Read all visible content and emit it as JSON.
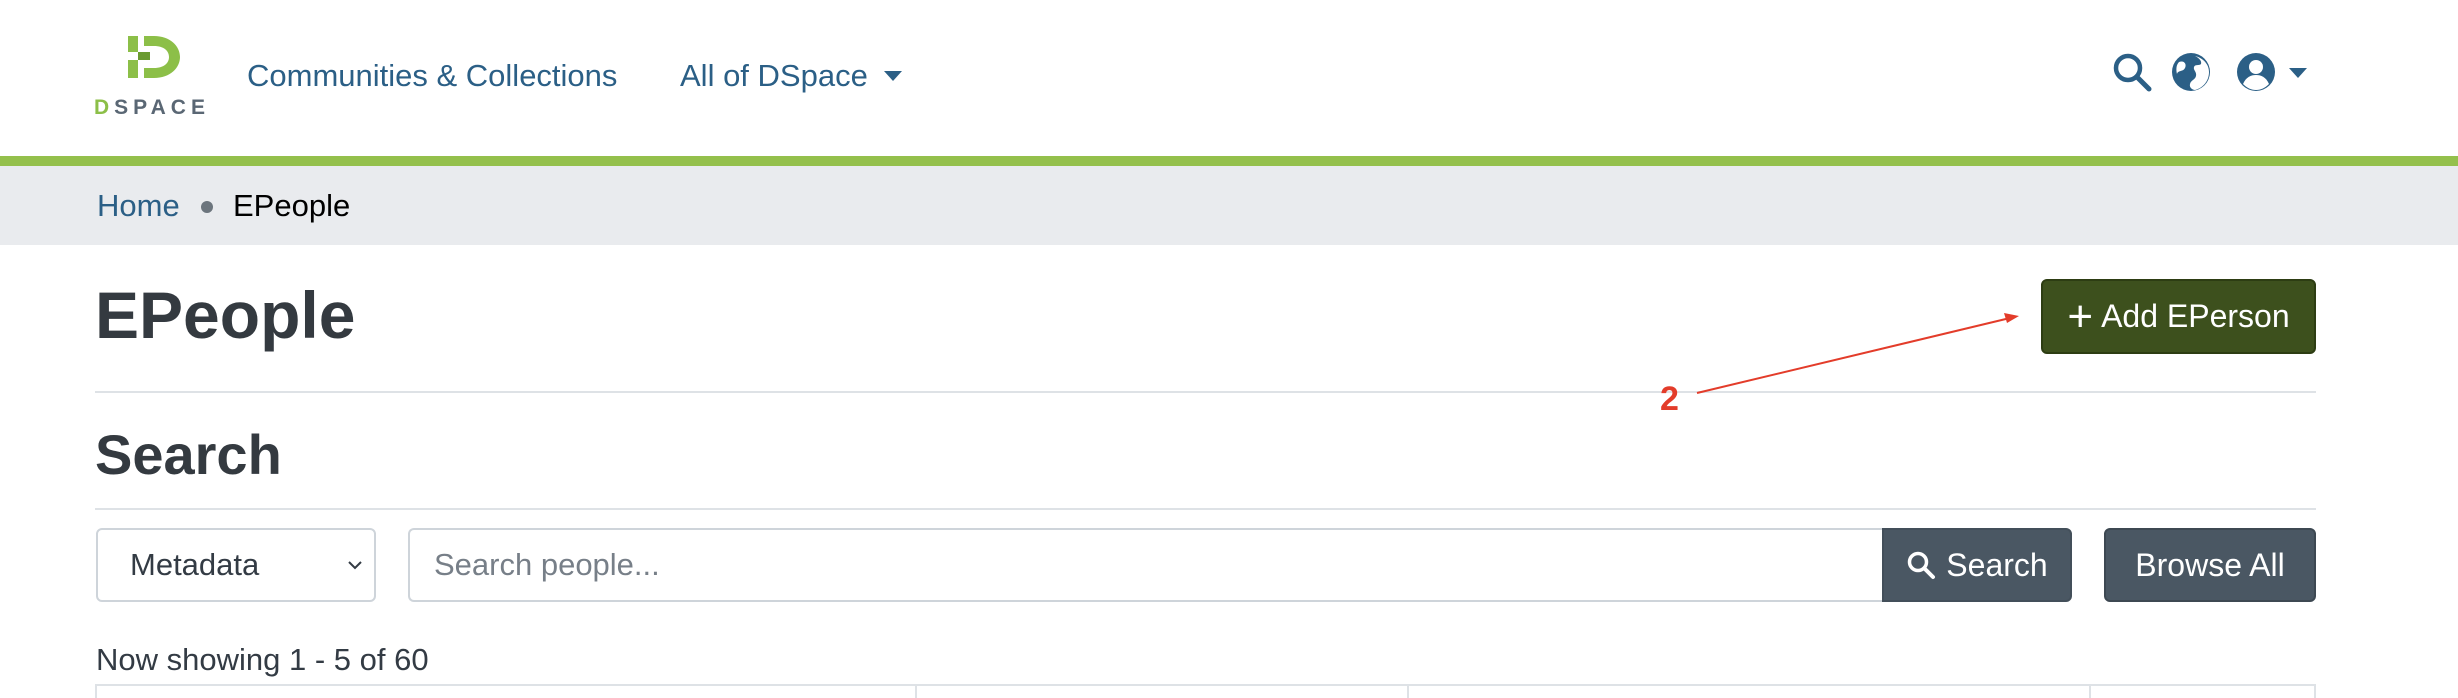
{
  "header": {
    "logo_text_first": "D",
    "logo_text_rest": "SPACE",
    "nav": {
      "communities_label": "Communities & Collections",
      "all_of_label": "All of DSpace"
    },
    "icons": [
      "search-icon",
      "globe-icon",
      "user-icon"
    ]
  },
  "breadcrumb": {
    "home": "Home",
    "current": "EPeople"
  },
  "page": {
    "title": "EPeople",
    "add_button_icon": "+",
    "add_button_label": "Add EPerson"
  },
  "annotation": {
    "label": "2"
  },
  "search": {
    "title": "Search",
    "scope_selected": "Metadata",
    "placeholder": "Search people...",
    "value": "",
    "search_button_label": "Search",
    "browse_button_label": "Browse All"
  },
  "results": {
    "showing_text": "Now showing 1 - 5 of 60"
  },
  "colors": {
    "accent_green": "#94c04c",
    "brand_dark_green": "#3d501d",
    "link_blue": "#2b5f86",
    "secondary_button": "#4a5763",
    "annotation_red": "#e33c2a",
    "breadcrumb_bg": "#e9ebee"
  }
}
